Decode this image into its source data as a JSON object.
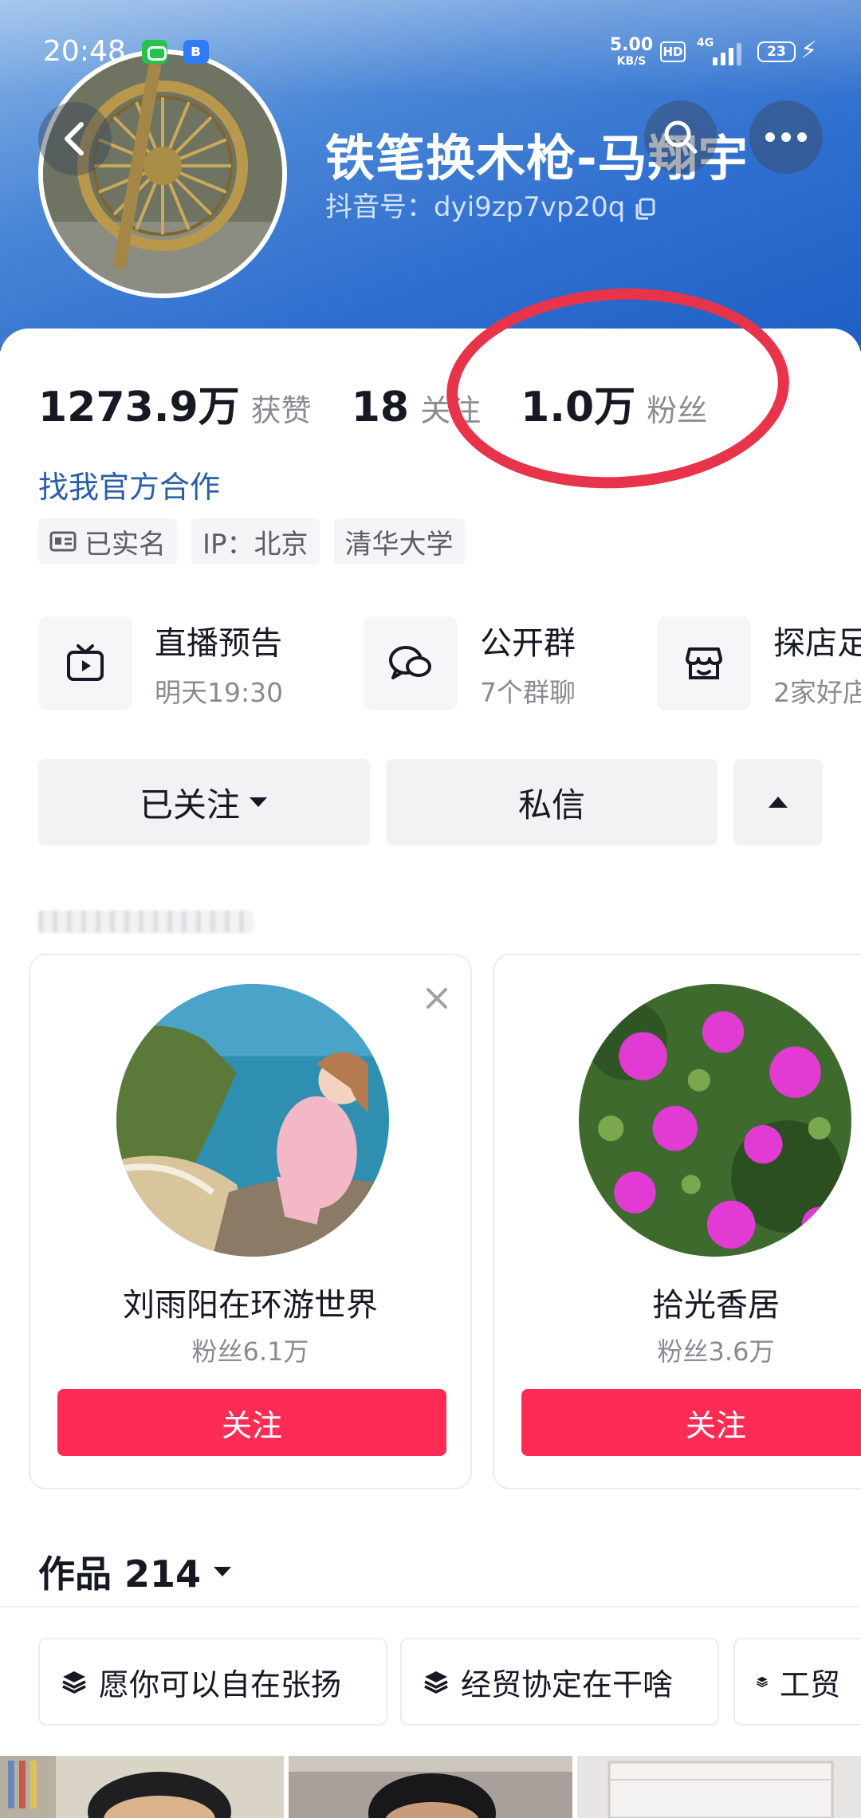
{
  "status_bar": {
    "time": "20:48",
    "net_speed_value": "5.00",
    "net_speed_unit": "KB/S",
    "hd_badge": "HD",
    "signal_label": "4G",
    "battery_level": "23"
  },
  "profile": {
    "nickname": "铁笔换木枪-马翔宇",
    "douyin_id": "抖音号：dyi9zp7vp20q",
    "likes_count": "1273.9万",
    "likes_label": "获赞",
    "following_count": "18",
    "following_label": "关注",
    "followers_count": "1.0万",
    "followers_label": "粉丝",
    "business_link": "找我官方合作",
    "tags": [
      "已实名",
      "IP：北京",
      "清华大学"
    ]
  },
  "features": [
    {
      "title": "直播预告",
      "subtitle": "明天19:30",
      "icon": "tv-icon"
    },
    {
      "title": "公开群",
      "subtitle": "7个群聊",
      "icon": "chat-bubbles-icon"
    },
    {
      "title": "探店足",
      "subtitle": "2家好店",
      "icon": "shop-icon"
    }
  ],
  "actions": {
    "followed_label": "已关注",
    "message_label": "私信"
  },
  "recommendations": [
    {
      "name": "刘雨阳在环游世界",
      "fans": "粉丝6.1万",
      "follow_label": "关注"
    },
    {
      "name": "拾光香居",
      "fans": "粉丝3.6万",
      "follow_label": "关注"
    }
  ],
  "works": {
    "title": "作品 214",
    "collections": [
      "愿你可以自在张扬",
      "经贸协定在干啥",
      "工贸"
    ]
  },
  "colors": {
    "accent_red": "#fe2c55",
    "link_blue": "#2a5ea8",
    "annotation_ring": "#e8344a",
    "header_blue": "#2f6fcf"
  }
}
